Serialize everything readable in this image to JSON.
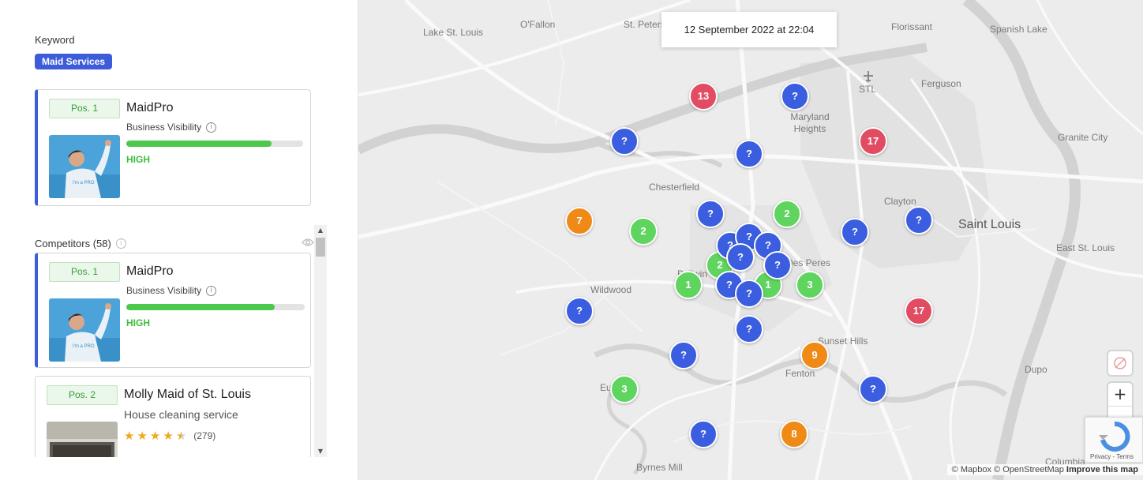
{
  "keyword": {
    "label": "Keyword",
    "value": "Maid Services"
  },
  "selected_business": {
    "position": "Pos. 1",
    "name": "MaidPro",
    "metric_label": "Business Visibility",
    "visibility_fraction": 0.82,
    "level": "HIGH"
  },
  "competitors": {
    "label": "Competitors (58)",
    "items": [
      {
        "position": "Pos. 1",
        "name": "MaidPro",
        "metric_label": "Business Visibility",
        "visibility_fraction": 0.83,
        "level": "HIGH"
      },
      {
        "position": "Pos. 2",
        "name": "Molly Maid of St. Louis",
        "category": "House cleaning service",
        "rating": 4.5,
        "reviews": "(279)"
      }
    ]
  },
  "map": {
    "timestamp": "12 September 2022 at 22:04",
    "places": [
      "Lake St. Louis",
      "O'Fallon",
      "St. Peters",
      "Florissant",
      "Spanish Lake",
      "STL",
      "Ferguson",
      "Maryland Heights",
      "Granite City",
      "Chesterfield",
      "Clayton",
      "Saint Louis",
      "East St. Louis",
      "Des Peres",
      "Wildwood",
      "Ballwin",
      "Sunset Hills",
      "Fenton",
      "Dupo",
      "Eureka",
      "Byrnes Mill",
      "Columbia"
    ],
    "markers": [
      {
        "label": "13",
        "color": "red"
      },
      {
        "label": "?",
        "color": "blue"
      },
      {
        "label": "17",
        "color": "red"
      },
      {
        "label": "?",
        "color": "blue"
      },
      {
        "label": "?",
        "color": "blue"
      },
      {
        "label": "?",
        "color": "blue"
      },
      {
        "label": "2",
        "color": "green"
      },
      {
        "label": "?",
        "color": "blue"
      },
      {
        "label": "?",
        "color": "blue"
      },
      {
        "label": "7",
        "color": "orange"
      },
      {
        "label": "2",
        "color": "green"
      },
      {
        "label": "2",
        "color": "green"
      },
      {
        "label": "1",
        "color": "green"
      },
      {
        "label": "1",
        "color": "green"
      },
      {
        "label": "3",
        "color": "green"
      },
      {
        "label": "?",
        "color": "blue"
      },
      {
        "label": "?",
        "color": "blue"
      },
      {
        "label": "?",
        "color": "blue"
      },
      {
        "label": "?",
        "color": "blue"
      },
      {
        "label": "?",
        "color": "blue"
      },
      {
        "label": "?",
        "color": "blue"
      },
      {
        "label": "?",
        "color": "blue"
      },
      {
        "label": "?",
        "color": "blue"
      },
      {
        "label": "17",
        "color": "red"
      },
      {
        "label": "?",
        "color": "blue"
      },
      {
        "label": "?",
        "color": "blue"
      },
      {
        "label": "9",
        "color": "orange"
      },
      {
        "label": "3",
        "color": "green"
      },
      {
        "label": "?",
        "color": "blue"
      },
      {
        "label": "?",
        "color": "blue"
      },
      {
        "label": "8",
        "color": "orange"
      }
    ],
    "controls": {
      "zoom_in": "+",
      "zoom_out": "−",
      "compass": "▲"
    },
    "attribution": {
      "mapbox": "© Mapbox",
      "osm": "© OpenStreetMap",
      "improve": "Improve this map"
    },
    "recaptcha": {
      "privacy": "Privacy",
      "terms": "Terms"
    }
  },
  "colors": {
    "accent": "#3d5cd9",
    "high": "#3cbf3c",
    "blue_marker": "#3b5ee0",
    "green_marker": "#5fd55f",
    "orange_marker": "#ef8a17",
    "red_marker": "#e14c63"
  }
}
